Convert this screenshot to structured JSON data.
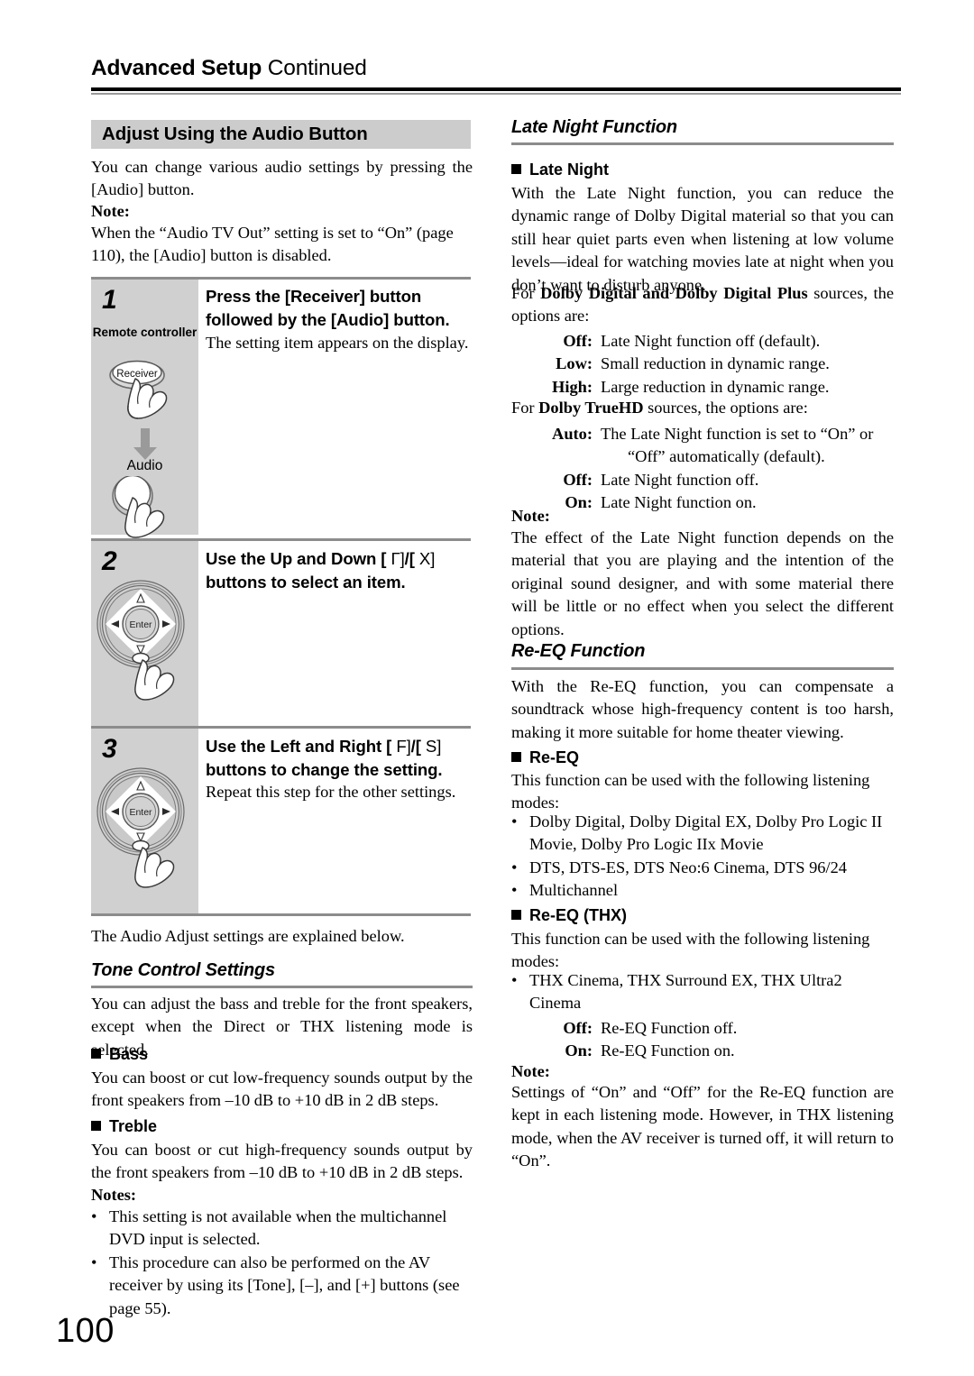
{
  "running_head": {
    "bold": "Advanced Setup",
    "light": "Continued"
  },
  "page_number": "100",
  "left_column": {
    "section_title": "Adjust Using the Audio Button",
    "intro": "You can change various audio settings by pressing the [Audio] button.",
    "note_label": "Note:",
    "note_text": "When the “Audio TV Out” setting is set to “On” (page 110), the [Audio] button is disabled.",
    "steps": [
      {
        "number": "1",
        "title": "Press the [Receiver] button followed by the [Audio] button.",
        "body": "The setting item appears on the display.",
        "illustration": {
          "caption": "Remote controller",
          "button_top_label": "Receiver",
          "button_bottom_label": "Audio"
        }
      },
      {
        "number": "2",
        "title_parts": [
          "Use the Up and Down [ ",
          "Γ]",
          "/[ ",
          "X]",
          " buttons to select an item."
        ],
        "title_plain": "Use the Up and Down [ Γ]/[ X] buttons to select an item.",
        "body": "",
        "illustration": {
          "center_label": "Enter"
        }
      },
      {
        "number": "3",
        "title_parts": [
          "Use the Left and Right [ ",
          "F]",
          "/[ ",
          "S]",
          " buttons to change the setting."
        ],
        "title_plain": "Use the Left and Right [ F]/[ S] buttons to change the setting.",
        "body": "Repeat this step for the other settings.",
        "illustration": {
          "center_label": "Enter"
        }
      }
    ],
    "after_steps": "The Audio Adjust settings are explained below.",
    "tone": {
      "heading": "Tone Control Settings",
      "intro": "You can adjust the bass and treble for the front speakers, except when the Direct or THX listening mode is selected.",
      "bass_heading": "Bass",
      "bass_text": "You can boost or cut low-frequency sounds output by the front speakers from –10 dB to +10 dB in 2 dB steps.",
      "treble_heading": "Treble",
      "treble_text": "You can boost or cut high-frequency sounds output by the front speakers from –10 dB to +10 dB in 2 dB steps.",
      "notes_label": "Notes:",
      "notes": [
        "This setting is not available when the multichannel DVD input is selected.",
        "This procedure can also be performed on the AV receiver by using its [Tone], [–], and [+] buttons (see page 55)."
      ]
    }
  },
  "right_column": {
    "late_night": {
      "heading": "Late Night Function",
      "sub_heading": "Late Night",
      "intro": "With the Late Night function, you can reduce the dynamic range of Dolby Digital material so that you can still hear quiet parts even when listening at low volume levels—ideal for watching movies late at night when you don’t want to disturb anyone.",
      "dd_lead_pre": "For ",
      "dd_lead_bold": "Dolby Digital and Dolby Digital Plus",
      "dd_lead_post": " sources, the options are:",
      "dd_options": [
        {
          "term": "Off:",
          "desc": "Late Night function off (default)."
        },
        {
          "term": "Low:",
          "desc": "Small reduction in dynamic range."
        },
        {
          "term": "High:",
          "desc": "Large reduction in dynamic range."
        }
      ],
      "thd_lead_pre": "For ",
      "thd_lead_bold": "Dolby TrueHD",
      "thd_lead_post": " sources, the options are:",
      "thd_options": [
        {
          "term": "Auto:",
          "desc": "The Late Night function is set to “On” or",
          "cont": "“Off” automatically (default)."
        },
        {
          "term": "Off:",
          "desc": "Late Night function off."
        },
        {
          "term": "On:",
          "desc": "Late Night function on."
        }
      ],
      "note_label": "Note:",
      "note_text": "The effect of the Late Night function depends on the material that you are playing and the intention of the original sound designer, and with some material there will be little or no effect when you select the different options."
    },
    "re_eq": {
      "heading": "Re-EQ Function",
      "intro": "With the Re-EQ function, you can compensate a soundtrack whose high-frequency content is too harsh, making it more suitable for home theater viewing.",
      "sub_heading": "Re-EQ",
      "modes_lead": "This function can be used with the following listening modes:",
      "modes": [
        "Dolby Digital, Dolby Digital EX, Dolby Pro Logic II Movie, Dolby Pro Logic IIx Movie",
        "DTS, DTS-ES, DTS Neo:6 Cinema, DTS 96/24",
        "Multichannel"
      ],
      "thx_sub_heading": "Re-EQ (THX)",
      "thx_modes_lead": "This function can be used with the following listening modes:",
      "thx_modes": [
        "THX Cinema, THX Surround EX, THX Ultra2 Cinema"
      ],
      "thx_options": [
        {
          "term": "Off:",
          "desc": "Re-EQ Function off."
        },
        {
          "term": "On:",
          "desc": "Re-EQ Function on."
        }
      ],
      "note_label": "Note:",
      "note_text": "Settings of “On” and “Off” for the Re-EQ function are kept in each listening mode. However, in THX listening mode, when the AV receiver is turned off, it will return to “On”."
    }
  }
}
